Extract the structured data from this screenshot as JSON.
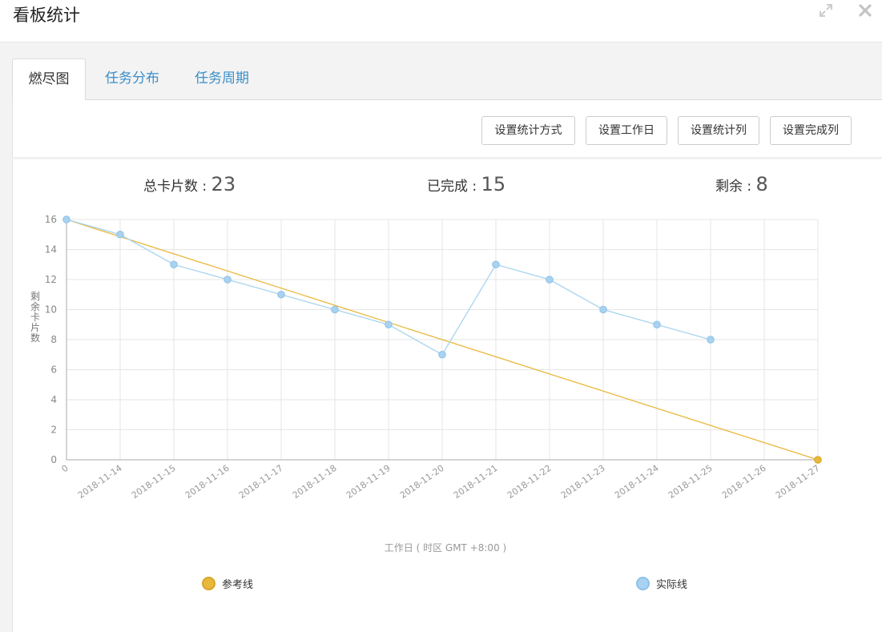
{
  "window": {
    "title": "看板统计",
    "expand_icon": "expand-icon",
    "close_icon": "close-icon"
  },
  "tabs": [
    {
      "label": "燃尽图",
      "active": true
    },
    {
      "label": "任务分布",
      "active": false
    },
    {
      "label": "任务周期",
      "active": false
    }
  ],
  "toolbar": {
    "buttons": [
      "设置统计方式",
      "设置工作日",
      "设置统计列",
      "设置完成列"
    ]
  },
  "stats": {
    "total_label": "总卡片数 : ",
    "total_value": "23",
    "done_label": "已完成 : ",
    "done_value": "15",
    "remaining_label": "剩余 : ",
    "remaining_value": "8"
  },
  "colors": {
    "reference": "#e8b83a",
    "actual": "#a8d4f0",
    "actual_dot": "#a9d2f0",
    "grid": "#e6e6e6",
    "axis": "#aaaaaa",
    "active_tab_text": "#333333",
    "tab_text": "#3a8ec9"
  },
  "chart_data": {
    "type": "line",
    "x": [
      "0",
      "2018-11-14",
      "2018-11-15",
      "2018-11-16",
      "2018-11-17",
      "2018-11-18",
      "2018-11-19",
      "2018-11-20",
      "2018-11-21",
      "2018-11-22",
      "2018-11-23",
      "2018-11-24",
      "2018-11-25",
      "2018-11-26",
      "2018-11-27"
    ],
    "series": [
      {
        "name": "参考线",
        "values": [
          16,
          null,
          null,
          null,
          null,
          null,
          null,
          null,
          null,
          null,
          null,
          null,
          null,
          null,
          0
        ]
      },
      {
        "name": "实际线",
        "values": [
          16,
          15,
          13,
          12,
          11,
          10,
          9,
          7,
          13,
          12,
          10,
          9,
          8,
          null,
          null
        ]
      }
    ],
    "ylabel": "剩余卡片数",
    "xlabel": "工作日 ( 时区 GMT +8:00 )",
    "ylim": [
      0,
      16
    ],
    "yticks": [
      0,
      2,
      4,
      6,
      8,
      10,
      12,
      14,
      16
    ],
    "grid": true,
    "legend_position": "bottom"
  }
}
